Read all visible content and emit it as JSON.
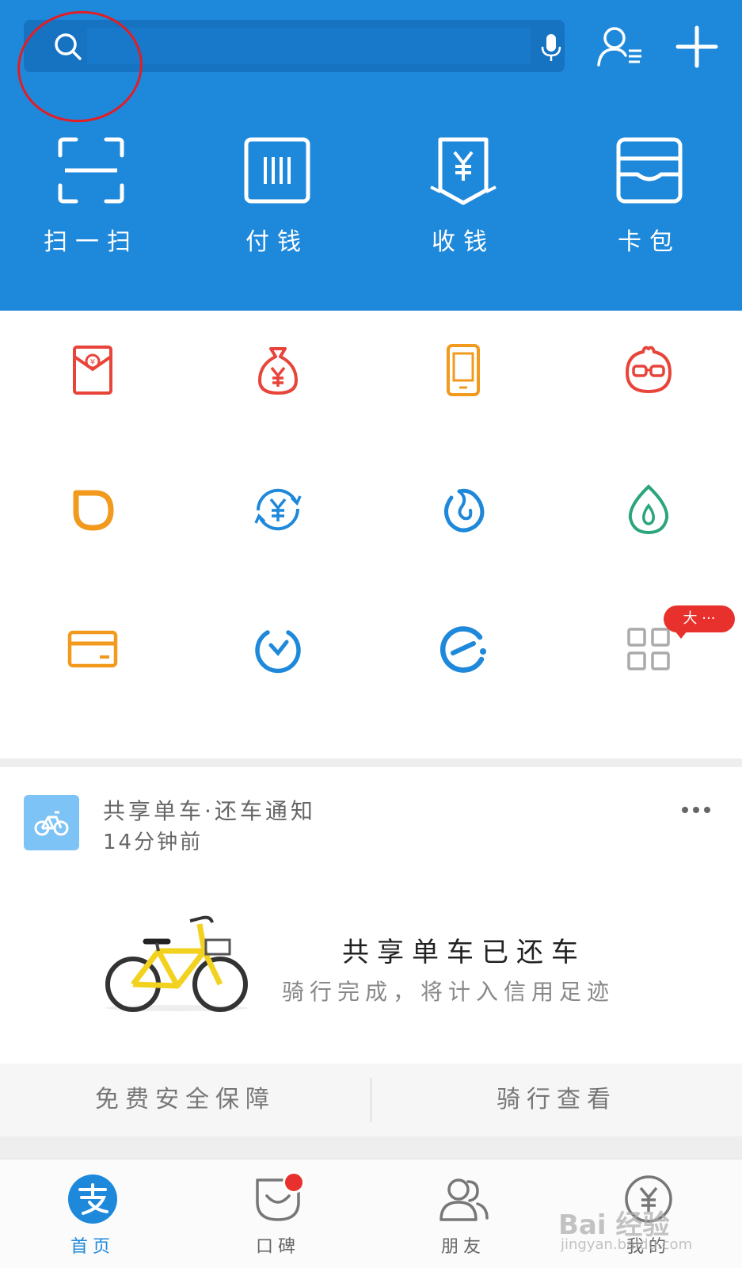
{
  "search": {
    "placeholder": ""
  },
  "quick_actions": [
    {
      "label": "扫一扫",
      "icon": "scan-icon"
    },
    {
      "label": "付钱",
      "icon": "barcode-icon"
    },
    {
      "label": "收钱",
      "icon": "receive-money-icon"
    },
    {
      "label": "卡包",
      "icon": "card-wallet-icon"
    }
  ],
  "grid_items": [
    {
      "icon": "red-packet-icon",
      "color": "#E8443A"
    },
    {
      "icon": "money-bag-icon",
      "color": "#E8443A"
    },
    {
      "icon": "phone-recharge-icon",
      "color": "#F29A1E"
    },
    {
      "icon": "glasses-face-icon",
      "color": "#E8443A"
    },
    {
      "icon": "didi-icon",
      "color": "#F29A1E"
    },
    {
      "icon": "currency-exchange-icon",
      "color": "#1E88DB"
    },
    {
      "icon": "swirl-icon",
      "color": "#1E88DB"
    },
    {
      "icon": "leaf-drop-icon",
      "color": "#2BA57B"
    },
    {
      "icon": "credit-card-icon",
      "color": "#F29A1E"
    },
    {
      "icon": "alarm-icon",
      "color": "#1E88DB"
    },
    {
      "icon": "eleme-icon",
      "color": "#1E88DB"
    },
    {
      "icon": "more-grid-icon",
      "color": "#AAAAAA"
    }
  ],
  "grid_badge": "大 ···",
  "card": {
    "title": "共享单车·还车通知",
    "time": "14分钟前",
    "main_message": "共享单车已还车",
    "sub_message": "骑行完成，将计入信用足迹",
    "actions": [
      "免费安全保障",
      "骑行查看"
    ]
  },
  "tabs": [
    {
      "label": "首页",
      "icon": "alipay-home-icon",
      "active": true
    },
    {
      "label": "口碑",
      "icon": "koubei-icon",
      "active": false
    },
    {
      "label": "朋友",
      "icon": "friends-icon",
      "active": false
    },
    {
      "label": "我的",
      "icon": "my-wealth-icon",
      "active": false
    }
  ],
  "watermark": {
    "text": "Bai 经验",
    "sub": "jingyan.baidu.com"
  }
}
